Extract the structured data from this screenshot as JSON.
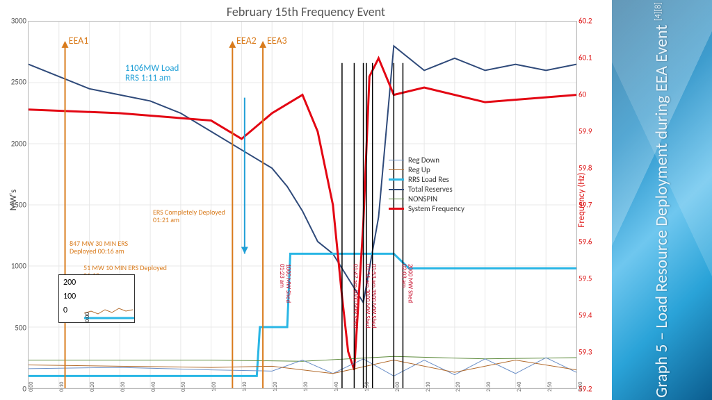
{
  "slide": {
    "side_title_main": "Graph 5 – Load Resource Deployment during EEA Event",
    "side_title_refs": "[4][8]"
  },
  "chart_data": {
    "type": "line",
    "title": "February 15th Frequency Event",
    "xlabel": "",
    "ylabel_left": "MW's",
    "ylabel_right": "Frequency (Hz)",
    "x_range": [
      "0:00",
      "3:00"
    ],
    "x_ticks": [
      "0:00",
      "0:10",
      "0:20",
      "0:30",
      "0:40",
      "0:50",
      "1:00",
      "1:10",
      "1:20",
      "1:30",
      "1:40",
      "1:50",
      "2:00",
      "2:10",
      "2:20",
      "2:30",
      "2:40",
      "2:50",
      "3:00"
    ],
    "ylim_left": [
      0,
      3000
    ],
    "yticks_left": [
      0,
      500,
      1000,
      1500,
      2000,
      2500,
      3000
    ],
    "ylim_right": [
      59.2,
      60.2
    ],
    "yticks_right": [
      59.2,
      59.3,
      59.4,
      59.5,
      59.6,
      59.7,
      59.8,
      59.9,
      60.0,
      60.1,
      60.2
    ],
    "legend": [
      {
        "name": "Reg Down",
        "color": "#6b8fc7",
        "width": 1
      },
      {
        "name": "Reg Up",
        "color": "#b26a2b",
        "width": 1
      },
      {
        "name": "RRS Load Res",
        "color": "#29b6e5",
        "width": 3
      },
      {
        "name": "Total Reserves",
        "color": "#2f4a7a",
        "width": 2
      },
      {
        "name": "NONSPIN",
        "color": "#5c8a3a",
        "width": 1
      },
      {
        "name": "System Frequency",
        "color": "#e30613",
        "width": 3
      }
    ],
    "series": [
      {
        "name": "Total Reserves",
        "axis": "left",
        "color": "#2f4a7a",
        "width": 2,
        "x": [
          0,
          10,
          20,
          30,
          40,
          50,
          60,
          70,
          80,
          85,
          90,
          95,
          100,
          105,
          110,
          115,
          120,
          130,
          140,
          150,
          160,
          170,
          180
        ],
        "y": [
          2650,
          2550,
          2450,
          2400,
          2350,
          2250,
          2100,
          1950,
          1800,
          1650,
          1450,
          1200,
          1100,
          900,
          700,
          1400,
          2800,
          2600,
          2700,
          2600,
          2650,
          2600,
          2650
        ]
      },
      {
        "name": "RRS Load Res",
        "axis": "left",
        "color": "#29b6e5",
        "width": 3,
        "x": [
          0,
          60,
          70,
          75,
          76,
          85,
          86,
          110,
          111,
          120,
          125,
          126,
          180
        ],
        "y": [
          100,
          100,
          100,
          100,
          500,
          500,
          1100,
          1100,
          1100,
          1100,
          980,
          980,
          980
        ]
      },
      {
        "name": "System Frequency",
        "axis": "right",
        "color": "#e30613",
        "width": 3,
        "x": [
          0,
          30,
          60,
          70,
          80,
          90,
          95,
          100,
          103,
          105,
          107,
          110,
          112,
          115,
          120,
          130,
          150,
          180
        ],
        "y": [
          59.96,
          59.95,
          59.93,
          59.88,
          59.95,
          60.0,
          59.9,
          59.7,
          59.45,
          59.3,
          59.25,
          59.65,
          60.05,
          60.1,
          60.0,
          60.02,
          59.98,
          60.0
        ]
      },
      {
        "name": "NONSPIN",
        "axis": "left",
        "color": "#5c8a3a",
        "width": 1,
        "x": [
          0,
          60,
          90,
          120,
          150,
          180
        ],
        "y": [
          230,
          230,
          220,
          260,
          240,
          250
        ]
      },
      {
        "name": "Reg Down",
        "axis": "left",
        "color": "#6b8fc7",
        "width": 1,
        "x": [
          0,
          30,
          60,
          80,
          90,
          100,
          110,
          120,
          130,
          140,
          150,
          160,
          170,
          180
        ],
        "y": [
          160,
          170,
          150,
          140,
          230,
          120,
          240,
          100,
          230,
          110,
          240,
          120,
          250,
          130
        ]
      },
      {
        "name": "Reg Up",
        "axis": "left",
        "color": "#b26a2b",
        "width": 1,
        "x": [
          0,
          30,
          60,
          80,
          100,
          120,
          140,
          160,
          180
        ],
        "y": [
          190,
          180,
          170,
          180,
          120,
          230,
          130,
          230,
          150
        ]
      }
    ],
    "event_markers": [
      {
        "label": "EEA1",
        "time": "0:12",
        "x_min": 12,
        "color": "#d97b1c"
      },
      {
        "label": "EEA2",
        "time": "1:07",
        "x_min": 67,
        "color": "#d97b1c"
      },
      {
        "label": "EEA3",
        "time": "1:17",
        "x_min": 77,
        "color": "#d97b1c"
      }
    ],
    "annotations": [
      {
        "text": "1106MW Load RRS 1:11 am",
        "x_min": 71,
        "kind": "cyan"
      },
      {
        "text": "847 MW 30 MIN ERS Deployed 00:16 am",
        "x_min": 16,
        "kind": "orange"
      },
      {
        "text": "51 MW 10 MIN ERS Deployed 01:19 am",
        "x_min": 79,
        "kind": "orange"
      },
      {
        "text": "ERS Completely Deployed 01:21 am",
        "x_min": 81,
        "kind": "orange"
      }
    ],
    "shed_events": [
      {
        "label": "01:23 am",
        "x_min": 83
      },
      {
        "label": "1000 MW Shed",
        "x_min": 85
      },
      {
        "label": "01:47 am  1000 MW Shed",
        "x_min": 107
      },
      {
        "label": "01:51 am  3000 MW Shed",
        "x_min": 111
      },
      {
        "label": "01:53 am  3500 MW Shed",
        "x_min": 113
      },
      {
        "label": "02:03 am",
        "x_min": 123
      },
      {
        "label": "2000 MW Shed",
        "x_min": 125
      }
    ],
    "black_vlines_x_min": [
      103,
      107,
      110,
      111,
      113,
      120,
      123
    ],
    "inset": {
      "yticks": [
        0,
        100,
        200
      ],
      "xstart": "0:00"
    }
  }
}
